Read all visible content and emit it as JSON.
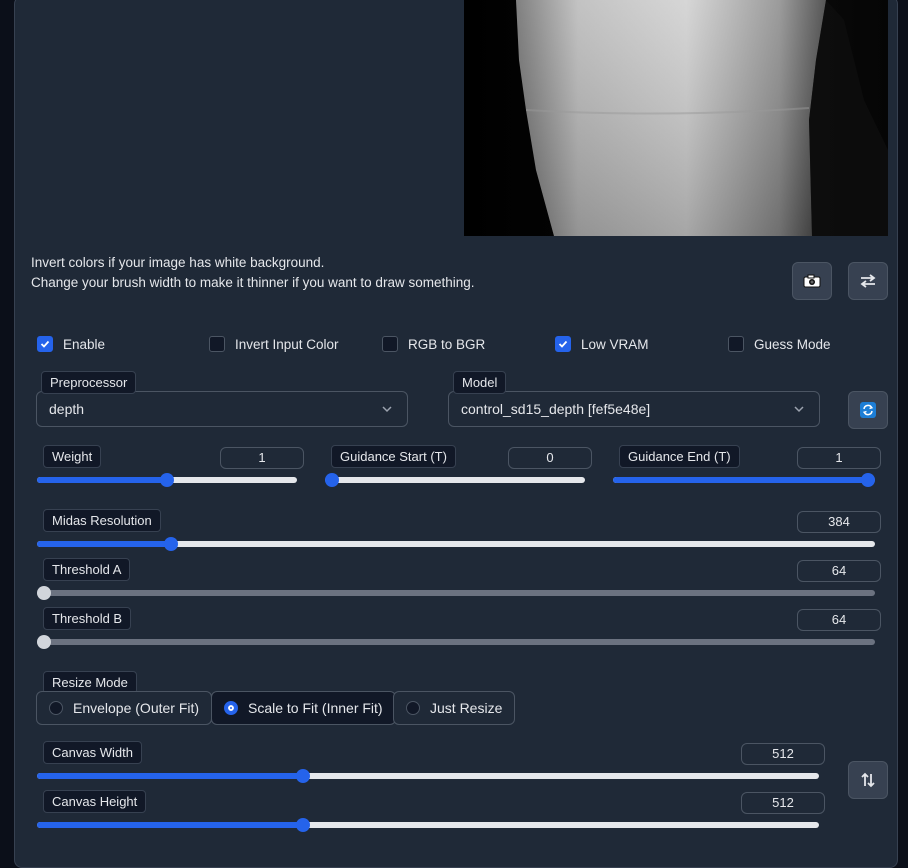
{
  "notes": {
    "line1": "Invert colors if your image has white background.",
    "line2": "Change your brush width to make it thinner if you want to draw something."
  },
  "icons": {
    "camera": "camera-icon",
    "swap": "swap-arrows-icon",
    "refresh": "refresh-icon",
    "swap_vertical": "swap-vertical-icon",
    "dropdown": "chevron-down-icon"
  },
  "checkboxes": [
    {
      "label": "Enable",
      "checked": true
    },
    {
      "label": "Invert Input Color",
      "checked": false
    },
    {
      "label": "RGB to BGR",
      "checked": false
    },
    {
      "label": "Low VRAM",
      "checked": true
    },
    {
      "label": "Guess Mode",
      "checked": false
    }
  ],
  "preprocessor": {
    "label": "Preprocessor",
    "value": "depth"
  },
  "model": {
    "label": "Model",
    "value": "control_sd15_depth [fef5e48e]"
  },
  "sliders": {
    "weight": {
      "label": "Weight",
      "value": "1",
      "fraction": 0.5
    },
    "guidance_start": {
      "label": "Guidance Start (T)",
      "value": "0",
      "fraction": 0.0
    },
    "guidance_end": {
      "label": "Guidance End (T)",
      "value": "1",
      "fraction": 1.0
    },
    "midas_resolution": {
      "label": "Midas Resolution",
      "value": "384",
      "fraction": 0.16
    },
    "threshold_a": {
      "label": "Threshold A",
      "value": "64",
      "fraction": 0.0
    },
    "threshold_b": {
      "label": "Threshold B",
      "value": "64",
      "fraction": 0.0
    },
    "canvas_width": {
      "label": "Canvas Width",
      "value": "512",
      "fraction": 0.34
    },
    "canvas_height": {
      "label": "Canvas Height",
      "value": "512",
      "fraction": 0.34
    }
  },
  "resize_mode": {
    "label": "Resize Mode",
    "options": [
      "Envelope (Outer Fit)",
      "Scale to Fit (Inner Fit)",
      "Just Resize"
    ],
    "selected": "Scale to Fit (Inner Fit)"
  },
  "colors": {
    "accent": "#2563eb",
    "panel": "#1f2937",
    "border": "#4b5563"
  }
}
